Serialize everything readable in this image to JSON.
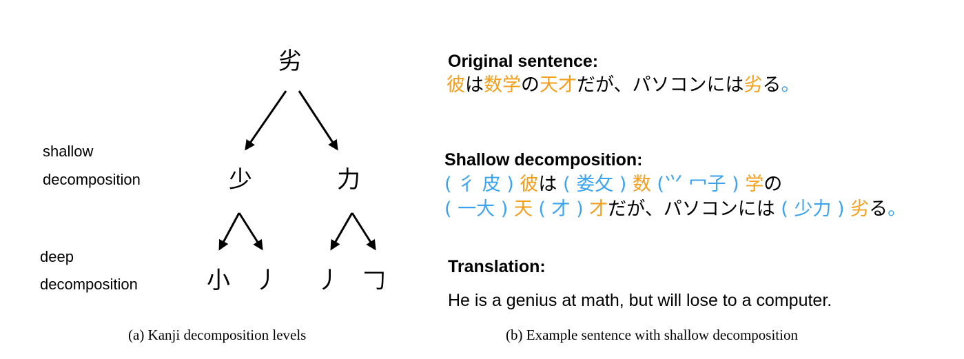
{
  "left_panel": {
    "root": "劣",
    "level1": [
      "少",
      "力"
    ],
    "level2": [
      "小",
      "丿",
      "丿",
      "𠃌"
    ],
    "shallow_label": [
      "shallow",
      "decomposition"
    ],
    "deep_label": [
      "deep",
      "decomposition"
    ],
    "caption": "(a) Kanji decomposition levels"
  },
  "right_panel": {
    "original_heading": "Original sentence:",
    "original_tokens": [
      {
        "t": "彼",
        "c": "orange"
      },
      {
        "t": "は",
        "c": "black"
      },
      {
        "t": "数学",
        "c": "orange"
      },
      {
        "t": "の",
        "c": "black"
      },
      {
        "t": "天才",
        "c": "orange"
      },
      {
        "t": "だが、パソコンには",
        "c": "black"
      },
      {
        "t": "劣",
        "c": "orange"
      },
      {
        "t": "る",
        "c": "black"
      },
      {
        "t": "。",
        "c": "blue"
      }
    ],
    "shallow_heading": "Shallow decomposition:",
    "shallow_line1": [
      {
        "t": "( 彳 皮 ) ",
        "c": "blue"
      },
      {
        "t": "彼",
        "c": "orange"
      },
      {
        "t": "は ",
        "c": "black"
      },
      {
        "t": "( 娄攵 ) ",
        "c": "blue"
      },
      {
        "t": "数",
        "c": "orange"
      },
      {
        "t": " (⺍ 冖子 ) ",
        "c": "blue"
      },
      {
        "t": "学",
        "c": "orange"
      },
      {
        "t": "の",
        "c": "black"
      }
    ],
    "shallow_line2": [
      {
        "t": "( 一大 ) ",
        "c": "blue"
      },
      {
        "t": "天",
        "c": "orange"
      },
      {
        "t": " ( 才 ) ",
        "c": "blue"
      },
      {
        "t": "才",
        "c": "orange"
      },
      {
        "t": "だが、パソコンには ",
        "c": "black"
      },
      {
        "t": "( 少力 ) ",
        "c": "blue"
      },
      {
        "t": "劣",
        "c": "orange"
      },
      {
        "t": "る",
        "c": "black"
      },
      {
        "t": "。",
        "c": "blue"
      }
    ],
    "translation_heading": "Translation:",
    "translation_text": "He is a genius at math, but will lose to a computer.",
    "caption": "(b) Example sentence with shallow decomposition"
  },
  "colors": {
    "orange": "#f59e1b",
    "blue": "#3aa3ef",
    "black": "#000000"
  }
}
